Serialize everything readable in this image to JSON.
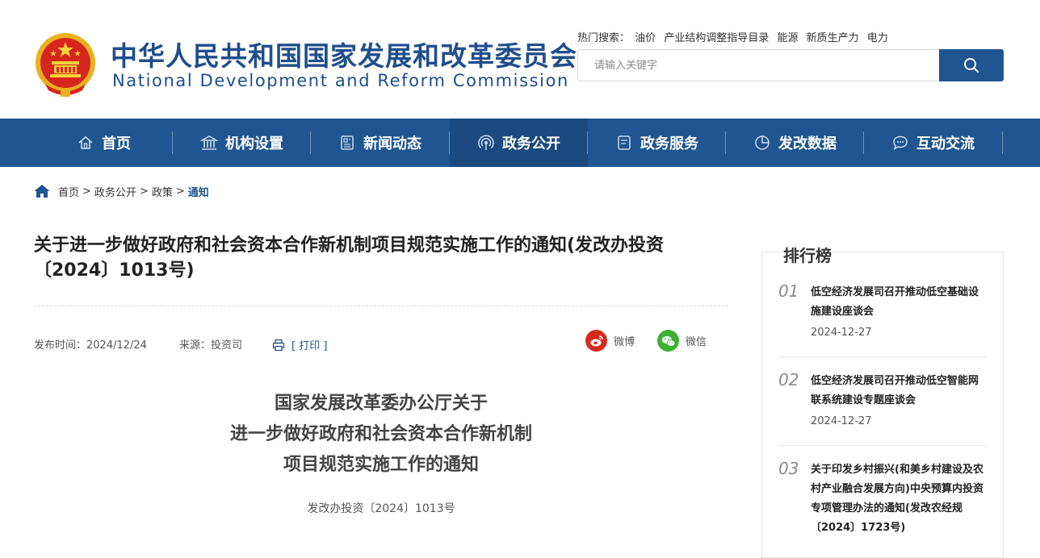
{
  "header": {
    "title_cn": "中华人民共和国国家发展和改革委员会",
    "title_en": "National Development and Reform Commission",
    "hot_search_label": "热门搜索：",
    "hot_search_terms": [
      "油价",
      "产业结构调整指导目录",
      "能源",
      "新质生产力",
      "电力"
    ],
    "search_placeholder": "请输入关键字"
  },
  "nav": {
    "items": [
      {
        "label": "首页",
        "icon": "home-icon"
      },
      {
        "label": "机构设置",
        "icon": "institution-icon"
      },
      {
        "label": "新闻动态",
        "icon": "news-icon"
      },
      {
        "label": "政务公开",
        "icon": "broadcast-icon"
      },
      {
        "label": "政务服务",
        "icon": "document-icon"
      },
      {
        "label": "发改数据",
        "icon": "pie-chart-icon"
      },
      {
        "label": "互动交流",
        "icon": "chat-icon"
      }
    ],
    "active_index": 3
  },
  "breadcrumb": {
    "items": [
      "首页",
      "政务公开",
      "政策"
    ],
    "separator": ">",
    "current": "通知"
  },
  "article": {
    "title": "关于进一步做好政府和社会资本合作新机制项目规范实施工作的通知(发改办投资〔2024〕1013号)",
    "publish_label": "发布时间：",
    "publish_date": "2024/12/24",
    "source_label": "来源：",
    "source": "投资司",
    "print_label": "[ 打印 ]",
    "share_weibo": "微博",
    "share_wechat": "微信",
    "heading_lines": [
      "国家发展改革委办公厅关于",
      "进一步做好政府和社会资本合作新机制",
      "项目规范实施工作的通知"
    ],
    "doc_number": "发改办投资〔2024〕1013号"
  },
  "ranking": {
    "title": "排行榜",
    "items": [
      {
        "num": "01",
        "title": "低空经济发展司召开推动低空基础设施建设座谈会",
        "date": "2024-12-27"
      },
      {
        "num": "02",
        "title": "低空经济发展司召开推动低空智能网联系统建设专题座谈会",
        "date": "2024-12-27"
      },
      {
        "num": "03",
        "title": "关于印发乡村振兴(和美乡村建设及农村产业融合发展方向)中央预算内投资专项管理办法的通知(发改农经规〔2024〕1723号)",
        "date": ""
      }
    ]
  },
  "colors": {
    "brand_blue": "#1f5590",
    "nav_active": "#1a4a80",
    "weibo_red": "#d52b1e",
    "wechat_green": "#3cb034"
  }
}
